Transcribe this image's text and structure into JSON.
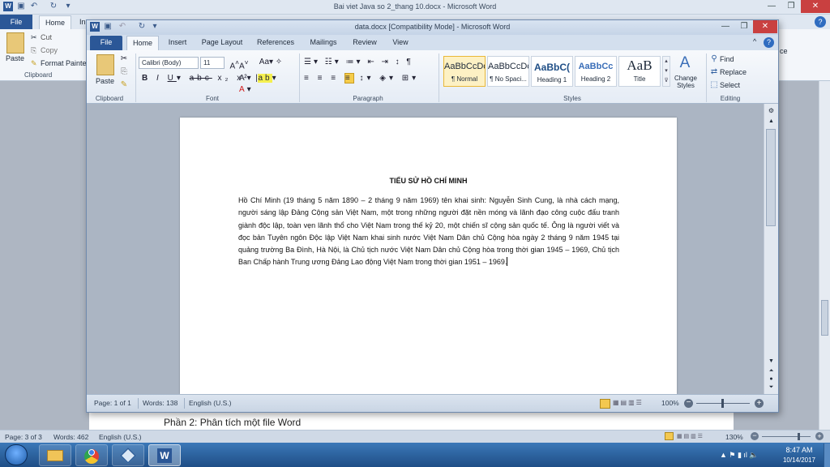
{
  "outer": {
    "title": "Bai viet Java so 2_thang 10.docx - Microsoft Word",
    "tabs": {
      "file": "File",
      "home": "Home",
      "partial": "In"
    },
    "clipboard": {
      "paste": "Paste",
      "cut": "Cut",
      "copy": "Copy",
      "format_painter": "Format Painte",
      "group": "Clipboard"
    },
    "editing_partial": "ce",
    "doc_heading": "Phần 2: Phân tích một file Word",
    "status": {
      "page": "Page: 3 of 3",
      "words": "Words: 462",
      "language": "English (U.S.)",
      "zoom": "130%"
    },
    "clock": {
      "time": "8:47 AM",
      "date": "10/14/2017"
    }
  },
  "inner": {
    "title": "data.docx [Compatibility Mode] - Microsoft Word",
    "tabs": [
      "File",
      "Home",
      "Insert",
      "Page Layout",
      "References",
      "Mailings",
      "Review",
      "View"
    ],
    "ribbon": {
      "clipboard_label": "Clipboard",
      "paste": "Paste",
      "font_label": "Font",
      "font_name": "Calibri (Body)",
      "font_size": "11",
      "paragraph_label": "Paragraph",
      "styles_label": "Styles",
      "styles": [
        {
          "sample": "AaBbCcDc",
          "name": "¶ Normal"
        },
        {
          "sample": "AaBbCcDc",
          "name": "¶ No Spaci..."
        },
        {
          "sample": "AaBbC(",
          "name": "Heading 1"
        },
        {
          "sample": "AaBbCc",
          "name": "Heading 2"
        },
        {
          "sample": "AaB",
          "name": "Title"
        }
      ],
      "change_styles": "Change Styles",
      "editing_label": "Editing",
      "find": "Find",
      "replace": "Replace",
      "select": "Select"
    },
    "document": {
      "title": "TIỂU SỬ HỒ CHÍ MINH",
      "body": "Hồ Chí Minh (19 tháng 5 năm 1890 – 2 tháng 9 năm 1969) tên khai sinh: Nguyễn Sinh Cung, là nhà cách mạng, người sáng lập Đảng Cộng sản Việt Nam, một trong những người đặt nền móng và lãnh đạo công cuộc đấu tranh giành độc lập, toàn vẹn lãnh thổ cho Việt Nam trong thế kỷ 20, một chiến sĩ cộng sản quốc tế. Ông là người viết và đọc bản Tuyên ngôn Độc lập Việt Nam khai sinh nước Việt Nam Dân chủ Cộng hòa ngày 2 tháng 9 năm 1945 tại quảng trường Ba Đình, Hà Nội, là Chủ tịch nước Việt Nam Dân chủ Cộng hòa trong thời gian 1945 – 1969, Chủ tịch Ban Chấp hành Trung ương Đảng Lao động Việt Nam trong thời gian 1951 – 1969."
    },
    "status": {
      "page": "Page: 1 of 1",
      "words": "Words: 138",
      "language": "English (U.S.)",
      "zoom": "100%"
    }
  },
  "colors": {
    "file_tab": "#2b5797",
    "taskbar": "#1f4e86",
    "ribbon": "#f3f6fa",
    "doc_bg": "#abb5c3"
  }
}
